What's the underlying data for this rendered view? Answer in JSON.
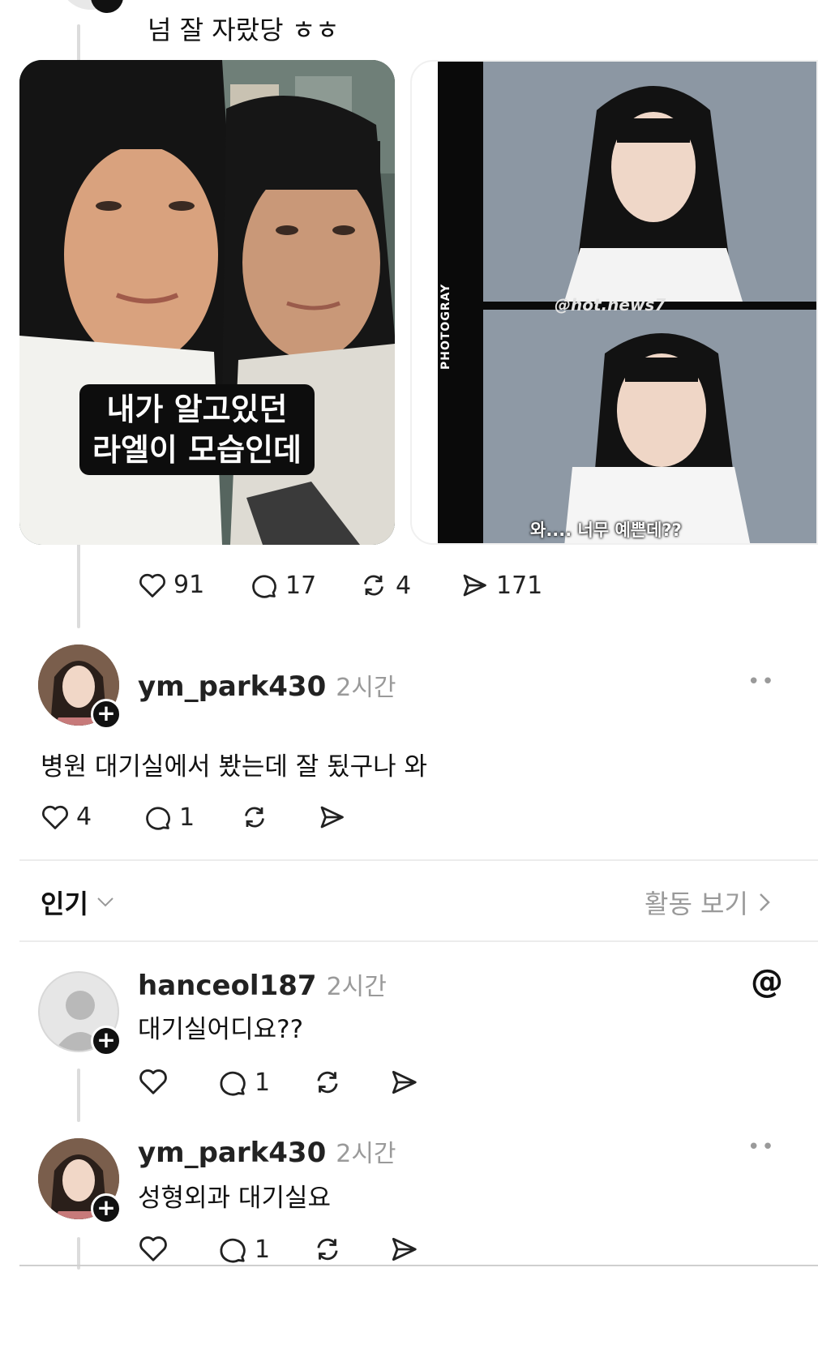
{
  "top_post": {
    "caption": "넘 잘 자랐당 ㅎㅎ",
    "image1_overlay": [
      "내가 알고있던",
      "라엘이 모습인데"
    ],
    "image2_side_label": "PHOTOGRAY",
    "image2_watermark": "@hot.news7",
    "image2_caption": "와.... 너무 예쁜데??",
    "likes": "91",
    "comments": "17",
    "reposts": "4",
    "shares": "171"
  },
  "reply1": {
    "username": "ym_park430",
    "time": "2시간",
    "text": "병원 대기실에서 봤는데 잘 됬구나 와",
    "likes": "4",
    "comments": "1"
  },
  "sort": {
    "label": "인기",
    "activity_label": "활동 보기"
  },
  "reply2": {
    "username": "hanceol187",
    "time": "2시간",
    "text": "대기실어디요??",
    "comments": "1"
  },
  "reply3": {
    "username": "ym_park430",
    "time": "2시간",
    "text": "성형외과 대기실요",
    "comments": "1"
  },
  "colors": {
    "text": "#111111",
    "muted": "#9a9a9a",
    "divider": "#ececec"
  }
}
